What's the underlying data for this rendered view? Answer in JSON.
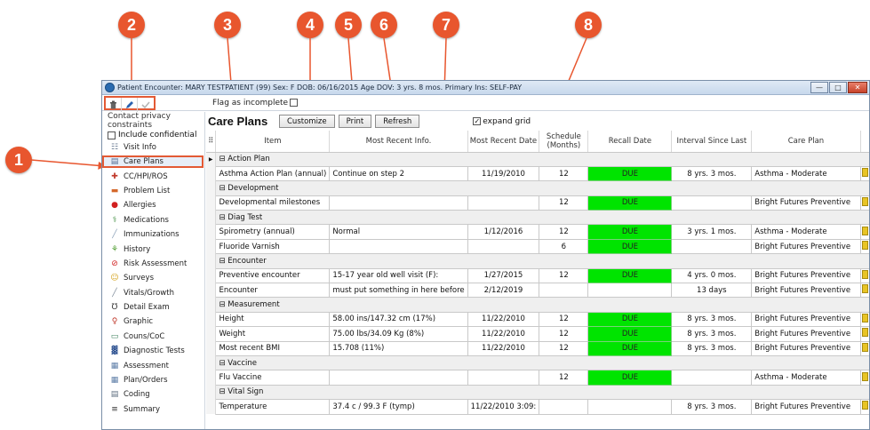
{
  "callouts": [
    "1",
    "2",
    "3",
    "4",
    "5",
    "6",
    "7",
    "8"
  ],
  "window": {
    "title": "Patient Encounter:  MARY TESTPATIENT (99)  Sex: F  DOB: 06/16/2015  Age DOV: 3 yrs. 8 mos.  Primary Ins: SELF-PAY",
    "buttons": {
      "minimize": "—",
      "maximize": "□",
      "close": "✕"
    }
  },
  "toolbar": {
    "icons": [
      "trash-icon",
      "pencil-icon",
      "checkmark-icon"
    ],
    "flag_label": "Flag as incomplete"
  },
  "sidebar": {
    "heading": "Contact privacy constraints",
    "include_confidential": "Include confidential",
    "items": [
      {
        "label": "Visit Info",
        "icon": "visit-info-icon",
        "glyph": "☷",
        "color": "#6b7c93"
      },
      {
        "label": "Care Plans",
        "icon": "care-plans-icon",
        "glyph": "▤",
        "color": "#4f6a8f"
      },
      {
        "label": "CC/HPI/ROS",
        "icon": "cc-hpi-ros-icon",
        "glyph": "✚",
        "color": "#c0392b"
      },
      {
        "label": "Problem List",
        "icon": "problem-list-icon",
        "glyph": "▬",
        "color": "#d4682c"
      },
      {
        "label": "Allergies",
        "icon": "allergies-icon",
        "glyph": "●",
        "color": "#d11f1f"
      },
      {
        "label": "Medications",
        "icon": "medications-icon",
        "glyph": "⚕",
        "color": "#3a8a3a"
      },
      {
        "label": "Immunizations",
        "icon": "immunizations-icon",
        "glyph": "╱",
        "color": "#8aa0b8"
      },
      {
        "label": "History",
        "icon": "history-icon",
        "glyph": "⚘",
        "color": "#4a9a2a"
      },
      {
        "label": "Risk Assessment",
        "icon": "risk-assessment-icon",
        "glyph": "⊘",
        "color": "#d11f1f"
      },
      {
        "label": "Surveys",
        "icon": "surveys-icon",
        "glyph": "☺",
        "color": "#d4a017"
      },
      {
        "label": "Vitals/Growth",
        "icon": "vitals-growth-icon",
        "glyph": "╱",
        "color": "#7f8c9a"
      },
      {
        "label": "Detail Exam",
        "icon": "detail-exam-icon",
        "glyph": "℧",
        "color": "#333333"
      },
      {
        "label": "Graphic",
        "icon": "graphic-icon",
        "glyph": "♀",
        "color": "#c0392b"
      },
      {
        "label": "Couns/CoC",
        "icon": "couns-coc-icon",
        "glyph": "▭",
        "color": "#3a7f5a"
      },
      {
        "label": "Diagnostic Tests",
        "icon": "diagnostic-tests-icon",
        "glyph": "▓",
        "color": "#2a4f8f"
      },
      {
        "label": "Assessment",
        "icon": "assessment-icon",
        "glyph": "▦",
        "color": "#5f7fa8"
      },
      {
        "label": "Plan/Orders",
        "icon": "plan-orders-icon",
        "glyph": "▦",
        "color": "#5f7fa8"
      },
      {
        "label": "Coding",
        "icon": "coding-icon",
        "glyph": "▤",
        "color": "#5f6f80"
      },
      {
        "label": "Summary",
        "icon": "summary-icon",
        "glyph": "≡",
        "color": "#333333"
      }
    ],
    "selected_index": 1
  },
  "main": {
    "title": "Care Plans",
    "customize_label": "Customize",
    "print_label": "Print",
    "refresh_label": "Refresh",
    "expand_label": "expand grid",
    "expand_checked": "✓",
    "columns": [
      "Item",
      "Most Recent Info.",
      "Most Recent Date",
      "Schedule (Months)",
      "Recall Date",
      "Interval Since Last",
      "Care Plan"
    ],
    "rows": [
      {
        "type": "category",
        "label": "Action Plan",
        "current": true
      },
      {
        "type": "item",
        "item": "Asthma Action Plan (annual)",
        "info": "Continue on step 2",
        "date": "11/19/2010",
        "schedule": "12",
        "recall": "DUE",
        "interval": "8 yrs. 3 mos.",
        "plan": "Asthma - Moderate"
      },
      {
        "type": "category",
        "label": "Development"
      },
      {
        "type": "item",
        "item": "Developmental milestones",
        "info": "",
        "date": "",
        "schedule": "12",
        "recall": "DUE",
        "interval": "",
        "plan": "Bright Futures Preventive"
      },
      {
        "type": "category",
        "label": "Diag Test"
      },
      {
        "type": "item",
        "item": "Spirometry (annual)",
        "info": "Normal",
        "date": "1/12/2016",
        "schedule": "12",
        "recall": "DUE",
        "interval": "3 yrs. 1 mos.",
        "plan": "Asthma - Moderate"
      },
      {
        "type": "item",
        "item": "Fluoride Varnish",
        "info": "",
        "date": "",
        "schedule": "6",
        "recall": "DUE",
        "interval": "",
        "plan": "Bright Futures Preventive"
      },
      {
        "type": "category",
        "label": "Encounter"
      },
      {
        "type": "item",
        "item": "Preventive encounter",
        "info": "15-17 year old well visit (F):",
        "date": "1/27/2015",
        "schedule": "12",
        "recall": "DUE",
        "interval": "4 yrs. 0 mos.",
        "plan": "Bright Futures Preventive"
      },
      {
        "type": "item",
        "item": "Encounter",
        "info": "must put something in here before",
        "date": "2/12/2019",
        "schedule": "",
        "recall": "",
        "interval": "13 days",
        "plan": "Bright Futures Preventive"
      },
      {
        "type": "category",
        "label": "Measurement"
      },
      {
        "type": "item",
        "item": "Height",
        "info": "58.00 ins/147.32 cm (17%)",
        "date": "11/22/2010",
        "schedule": "12",
        "recall": "DUE",
        "interval": "8 yrs. 3 mos.",
        "plan": "Bright Futures Preventive"
      },
      {
        "type": "item",
        "item": "Weight",
        "info": "75.00 lbs/34.09 Kg (8%)",
        "date": "11/22/2010",
        "schedule": "12",
        "recall": "DUE",
        "interval": "8 yrs. 3 mos.",
        "plan": "Bright Futures Preventive"
      },
      {
        "type": "item",
        "item": "Most recent BMI",
        "info": "15.708 (11%)",
        "date": "11/22/2010",
        "schedule": "12",
        "recall": "DUE",
        "interval": "8 yrs. 3 mos.",
        "plan": "Bright Futures Preventive"
      },
      {
        "type": "category",
        "label": "Vaccine"
      },
      {
        "type": "item",
        "item": "Flu Vaccine",
        "info": "",
        "date": "",
        "schedule": "12",
        "recall": "DUE",
        "interval": "",
        "plan": "Asthma - Moderate"
      },
      {
        "type": "category",
        "label": "Vital Sign"
      },
      {
        "type": "item",
        "item": "Temperature",
        "info": "37.4 c / 99.3 F (tymp)",
        "date": "11/22/2010 3:09:",
        "schedule": "",
        "recall": "",
        "interval": "8 yrs. 3 mos.",
        "plan": "Bright Futures Preventive"
      }
    ]
  },
  "colors": {
    "accent": "#e8562e",
    "due_green": "#00e400",
    "selected": "#e7eef8"
  }
}
